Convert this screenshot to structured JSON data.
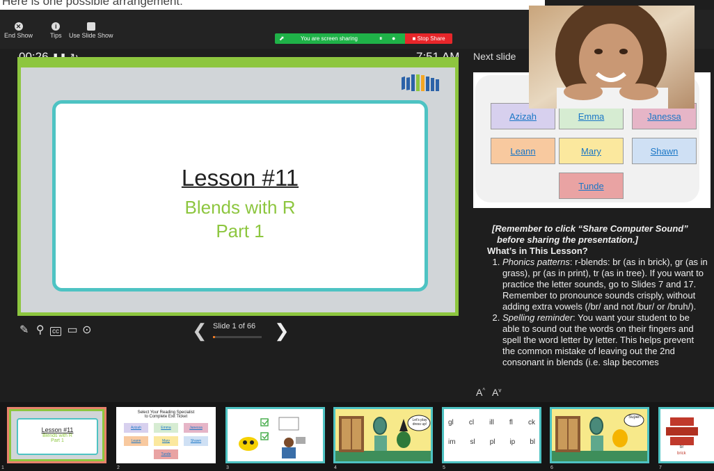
{
  "caption": "Here is one possible arrangement:",
  "toolbar": {
    "end_show": "End Show",
    "tips": "Tips",
    "use_slide_show": "Use Slide Show"
  },
  "sharing": {
    "message": "You are screen sharing",
    "stop_label": "Stop Share"
  },
  "timer": "00:26",
  "clock": "7:51 AM",
  "slide": {
    "title": "Lesson #11",
    "subtitle1": "Blends with R",
    "subtitle2": "Part 1"
  },
  "navigation": {
    "counter": "Slide 1 of 66",
    "progress": 0.015
  },
  "next_slide": {
    "label": "Next slide",
    "names": [
      "Azizah",
      "Emma",
      "Janessa",
      "Leann",
      "Mary",
      "Shawn",
      "Tunde"
    ]
  },
  "notes": {
    "reminder": "[Remember to click “Share Computer Sound” before sharing the presentation.]",
    "heading": "What’s in This Lesson?",
    "item1_label": "Phonics patterns",
    "item1_text": ": r-blends: br (as in brick), gr (as in grass), pr (as in print), tr (as in tree). If you want to practice the letter sounds, go to Slides 7 and 17. Remember to pronounce sounds crisply, without adding extra vowels (/br/ and not /bur/ or /bruh/).",
    "item2_label": "Spelling reminder",
    "item2_text": ": You want your student to be able to sound out the words on their fingers and spell the word letter by letter. This helps prevent the common mistake of leaving out the 2nd consonant in blends (i.e. slap becomes"
  },
  "font_controls": [
    "A",
    "A"
  ],
  "thumbnails": {
    "t1": {
      "title": "Lesson #11",
      "sub1": "Blends with R",
      "sub2": "Part 1"
    },
    "t2": {
      "title": "Select Your Reading Specialist",
      "title2": "to Complete Exit Ticket",
      "names": [
        "Azizah",
        "Emma",
        "Janessa",
        "Leann",
        "Mary",
        "Shawn",
        "Tunde"
      ]
    },
    "t4": {
      "bubble": "Let's play dress up!"
    },
    "t5": {
      "row1": [
        "gl",
        "cl",
        "ill",
        "fl",
        "ck"
      ],
      "row2": [
        "im",
        "sl",
        "pl",
        "ip",
        "bl"
      ]
    },
    "t6": {
      "bubble": "Super!"
    },
    "t7": {
      "word1": "br",
      "word2": "brick"
    },
    "numbers": [
      "1",
      "2",
      "3",
      "4",
      "5",
      "6",
      "7"
    ]
  },
  "colors": {
    "slide_border": "#8dc63f",
    "card_border": "#4ec3c3",
    "share_bar": "#1fb248",
    "stop_share": "#e8262a"
  }
}
